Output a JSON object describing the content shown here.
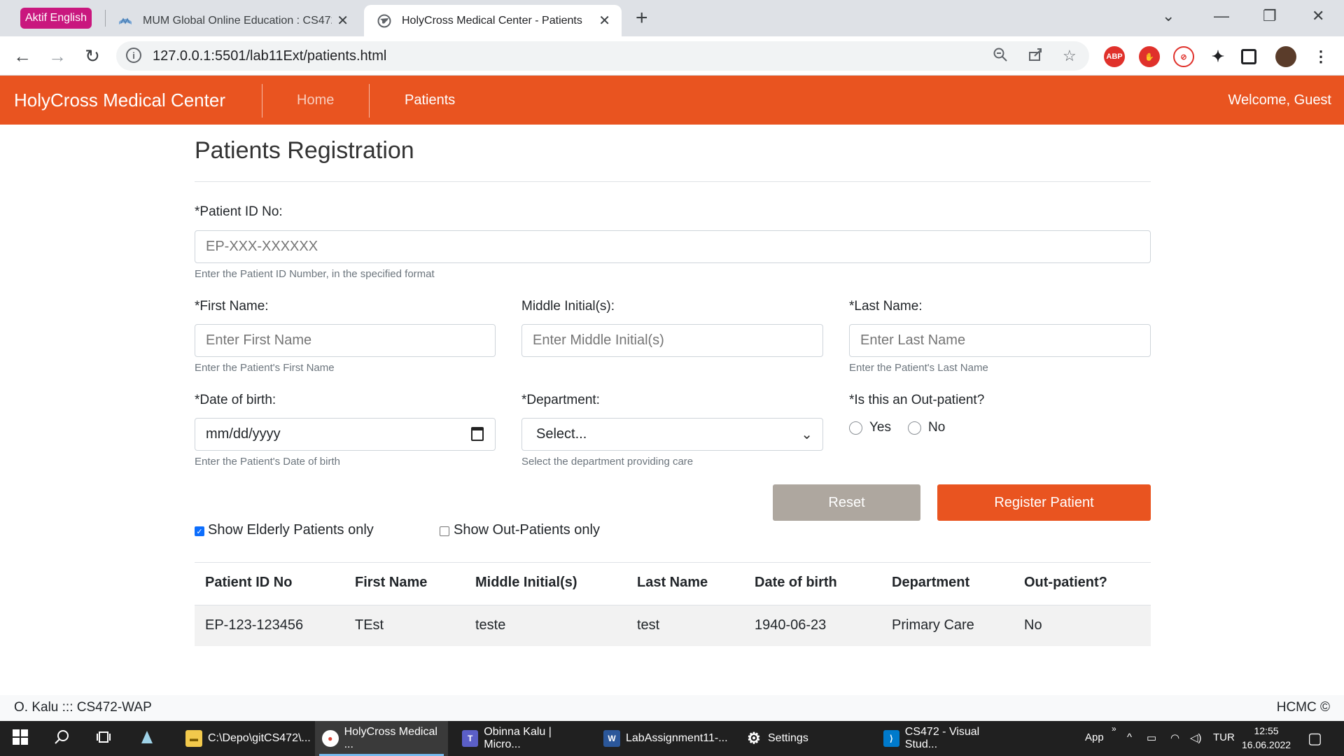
{
  "browser": {
    "profile_label": "Aktif English",
    "tabs": [
      {
        "title": "MUM Global Online Education : CS472-",
        "active": false
      },
      {
        "title": "HolyCross Medical Center - Patients",
        "active": true
      }
    ],
    "url": "127.0.0.1:5501/lab11Ext/patients.html",
    "extensions": [
      "abp-icon",
      "ublock-icon",
      "ext-red-icon",
      "puzzle-icon",
      "media-icon",
      "avatar"
    ]
  },
  "header": {
    "brand": "HolyCross Medical Center",
    "nav": [
      {
        "label": "Home"
      },
      {
        "label": "Patients"
      }
    ],
    "welcome": "Welcome, Guest"
  },
  "form": {
    "title": "Patients Registration",
    "patient_id": {
      "label": "*Patient ID No:",
      "placeholder": "EP-XXX-XXXXXX",
      "help": "Enter the Patient ID Number, in the specified format"
    },
    "first_name": {
      "label": "*First Name:",
      "placeholder": "Enter First Name",
      "help": "Enter the Patient's First Name"
    },
    "middle": {
      "label": "Middle Initial(s):",
      "placeholder": "Enter Middle Initial(s)"
    },
    "last_name": {
      "label": "*Last Name:",
      "placeholder": "Enter Last Name",
      "help": "Enter the Patient's Last Name"
    },
    "dob": {
      "label": "*Date of birth:",
      "value": "mm/dd/yyyy",
      "help": "Enter the Patient's Date of birth"
    },
    "department": {
      "label": "*Department:",
      "value": "Select...",
      "help": "Select the department providing care"
    },
    "outpatient": {
      "label": "*Is this an Out-patient?",
      "options": [
        "Yes",
        "No"
      ]
    },
    "reset_label": "Reset",
    "register_label": "Register Patient"
  },
  "filters": {
    "elderly": {
      "label": "Show Elderly Patients only",
      "checked": true
    },
    "outpatients": {
      "label": "Show Out-Patients only",
      "checked": false
    }
  },
  "table": {
    "headers": [
      "Patient ID No",
      "First Name",
      "Middle Initial(s)",
      "Last Name",
      "Date of birth",
      "Department",
      "Out-patient?"
    ],
    "rows": [
      [
        "EP-123-123456",
        "TEst",
        "teste",
        "test",
        "1940-06-23",
        "Primary Care",
        "No"
      ]
    ]
  },
  "footer": {
    "left": "O. Kalu ::: CS472-WAP",
    "right": "HCMC ©"
  },
  "taskbar": {
    "apps": [
      {
        "label": "C:\\Depo\\gitCS472\\...",
        "icon": "folder-icon"
      },
      {
        "label": "HolyCross Medical ...",
        "icon": "chrome-icon",
        "active": true
      },
      {
        "label": "Obinna Kalu | Micro...",
        "icon": "teams-icon"
      },
      {
        "label": "LabAssignment11-...",
        "icon": "word-icon"
      },
      {
        "label": "Settings",
        "icon": "gear-icon"
      },
      {
        "label": "CS472 - Visual Stud...",
        "icon": "vscode-icon"
      }
    ],
    "tray_app": "App",
    "lang": "TUR",
    "time": "12:55",
    "date": "16.06.2022"
  }
}
